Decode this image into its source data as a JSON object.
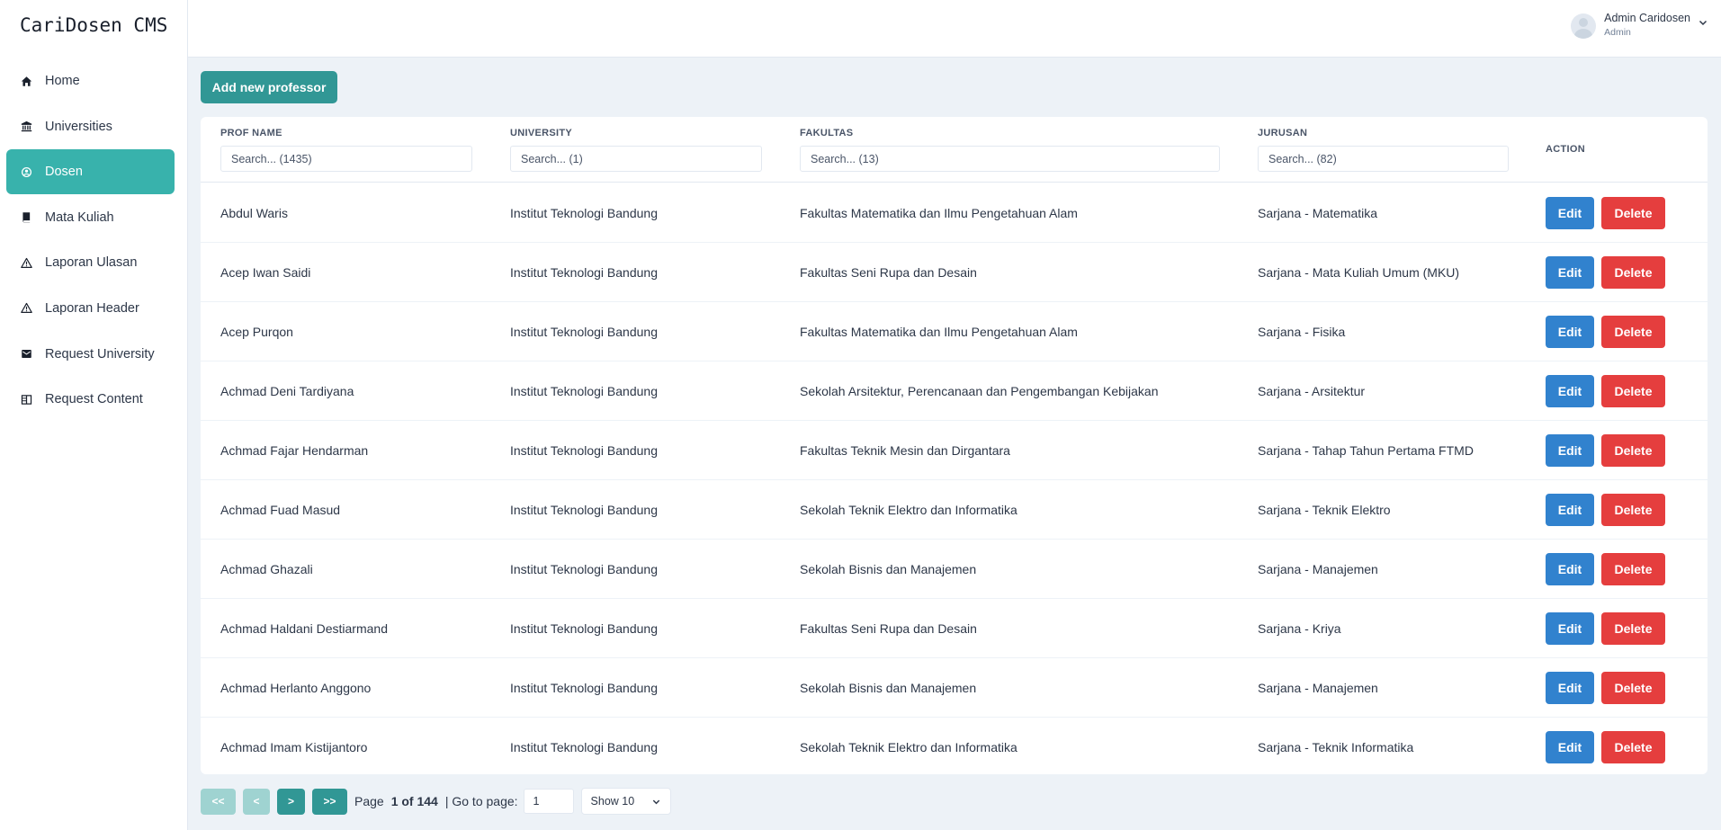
{
  "app": {
    "brand": "CariDosen CMS"
  },
  "sidebar": {
    "items": [
      {
        "label": "Home",
        "icon": "home-icon",
        "active": false
      },
      {
        "label": "Universities",
        "icon": "university-icon",
        "active": false
      },
      {
        "label": "Dosen",
        "icon": "dosen-icon",
        "active": true
      },
      {
        "label": "Mata Kuliah",
        "icon": "book-icon",
        "active": false
      },
      {
        "label": "Laporan Ulasan",
        "icon": "warning-icon",
        "active": false
      },
      {
        "label": "Laporan Header",
        "icon": "warning-icon",
        "active": false
      },
      {
        "label": "Request University",
        "icon": "mail-icon",
        "active": false
      },
      {
        "label": "Request Content",
        "icon": "columns-icon",
        "active": false
      }
    ]
  },
  "header": {
    "user_name": "Admin Caridosen",
    "user_role": "Admin"
  },
  "toolbar": {
    "add_label": "Add new professor"
  },
  "table": {
    "columns": [
      {
        "label": "PROF NAME",
        "placeholder": "Search... (1435)"
      },
      {
        "label": "UNIVERSITY",
        "placeholder": "Search... (1)"
      },
      {
        "label": "FAKULTAS",
        "placeholder": "Search... (13)"
      },
      {
        "label": "JURUSAN",
        "placeholder": "Search... (82)"
      }
    ],
    "action_label": "ACTION",
    "edit_label": "Edit",
    "delete_label": "Delete",
    "rows": [
      [
        "Abdul Waris",
        "Institut Teknologi Bandung",
        "Fakultas Matematika dan Ilmu Pengetahuan Alam",
        "Sarjana - Matematika"
      ],
      [
        "Acep Iwan Saidi",
        "Institut Teknologi Bandung",
        "Fakultas Seni Rupa dan Desain",
        "Sarjana - Mata Kuliah Umum (MKU)"
      ],
      [
        "Acep Purqon",
        "Institut Teknologi Bandung",
        "Fakultas Matematika dan Ilmu Pengetahuan Alam",
        "Sarjana - Fisika"
      ],
      [
        "Achmad Deni Tardiyana",
        "Institut Teknologi Bandung",
        "Sekolah Arsitektur, Perencanaan dan Pengembangan Kebijakan",
        "Sarjana - Arsitektur"
      ],
      [
        "Achmad Fajar Hendarman",
        "Institut Teknologi Bandung",
        "Fakultas Teknik Mesin dan Dirgantara",
        "Sarjana - Tahap Tahun Pertama FTMD"
      ],
      [
        "Achmad Fuad Masud",
        "Institut Teknologi Bandung",
        "Sekolah Teknik Elektro dan Informatika",
        "Sarjana - Teknik Elektro"
      ],
      [
        "Achmad Ghazali",
        "Institut Teknologi Bandung",
        "Sekolah Bisnis dan Manajemen",
        "Sarjana - Manajemen"
      ],
      [
        "Achmad Haldani Destiarmand",
        "Institut Teknologi Bandung",
        "Fakultas Seni Rupa dan Desain",
        "Sarjana - Kriya"
      ],
      [
        "Achmad Herlanto Anggono",
        "Institut Teknologi Bandung",
        "Sekolah Bisnis dan Manajemen",
        "Sarjana - Manajemen"
      ],
      [
        "Achmad Imam Kistijantoro",
        "Institut Teknologi Bandung",
        "Sekolah Teknik Elektro dan Informatika",
        "Sarjana - Teknik Informatika"
      ]
    ]
  },
  "pagination": {
    "first_label": "<<",
    "prev_label": "<",
    "next_label": ">",
    "last_label": ">>",
    "page_prefix": "Page",
    "page_status": "1 of 144",
    "goto_label": "| Go to page:",
    "goto_value": "1",
    "show_label": "Show 10"
  },
  "colors": {
    "accent": "#38b2ac",
    "primary_button": "#319795",
    "edit": "#3182ce",
    "delete": "#e53e3e"
  }
}
